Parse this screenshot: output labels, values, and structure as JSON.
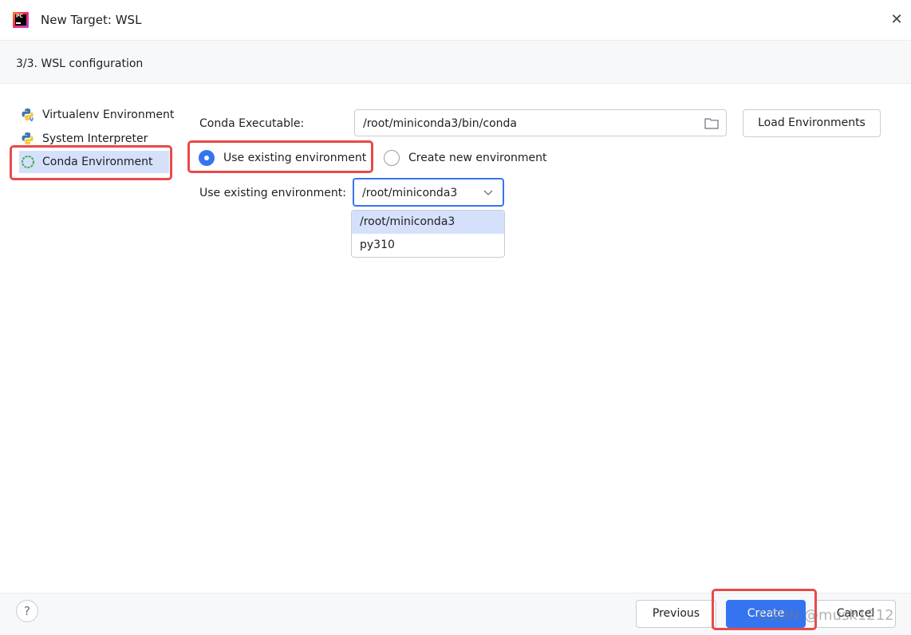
{
  "window": {
    "title": "New Target: WSL",
    "close_label": "✕"
  },
  "header": {
    "step_label": "3/3. WSL configuration"
  },
  "sidebar": {
    "items": [
      {
        "label": "Virtualenv Environment",
        "icon": "virtualenv-python-icon"
      },
      {
        "label": "System Interpreter",
        "icon": "python-icon"
      },
      {
        "label": "Conda Environment",
        "icon": "conda-icon",
        "selected": true
      }
    ]
  },
  "form": {
    "conda_executable_label": "Conda Executable:",
    "conda_executable_value": "/root/miniconda3/bin/conda",
    "load_environments_label": "Load Environments",
    "radio_use_existing_label": "Use existing environment",
    "radio_create_new_label": "Create new environment",
    "selected_radio": "use_existing",
    "existing_env_label": "Use existing environment:",
    "existing_env_value": "/root/miniconda3",
    "env_options": [
      "/root/miniconda3",
      "py310"
    ]
  },
  "footer": {
    "help_label": "?",
    "previous_label": "Previous",
    "create_label": "Create",
    "cancel_label": "Cancel",
    "watermark": "CSDN @musk1212"
  },
  "colors": {
    "accent": "#3574f0",
    "highlight_box": "#e84a4a",
    "selected_item_bg": "#d5e1fb"
  }
}
